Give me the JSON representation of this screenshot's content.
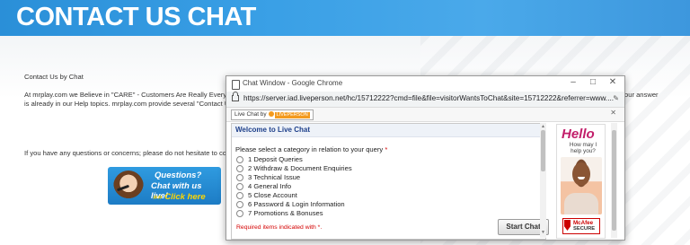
{
  "banner": {
    "title": "CONTACT US CHAT"
  },
  "page": {
    "heading": "Contact Us by Chat",
    "para1_line1": "At mrplay.com we Believe in \"CARE\" - Customers Are Really Everything",
    "para1_line1_tail": "our answer",
    "para1_line2": "is already in our Help topics. mrplay.com provide several \"Contact Us\"",
    "para2": "If you have any questions or concerns; please do not hesitate to contac"
  },
  "chat_button": {
    "line1": "Questions?",
    "line2": "Chat with us live!",
    "line3": "»» Click here"
  },
  "popup": {
    "window_title": "Chat Window - Google Chrome",
    "url": "https://server.iad.liveperson.net/hc/15712222?cmd=file&file=visitorWantsToChat&site=15712222&referrer=www....",
    "lp_badge_text": "Live Chat by",
    "lp_brand": "LIVEPERSON",
    "welcome": "Welcome to Live Chat",
    "prompt": "Please select a category in relation to your query",
    "required_marker": "*",
    "options": [
      "1 Deposit Queries",
      "2 Withdraw & Document Enquiries",
      "3 Technical Issue",
      "4 General Info",
      "5 Close Account",
      "6 Password & Login Information",
      "7 Promotions & Bonuses"
    ],
    "required_note": "Required items indicated with *.",
    "start_chat": "Start Chat"
  },
  "ad": {
    "hello": "Hello",
    "sub": "How may I help you?",
    "badge_line1": "McAfee",
    "badge_line2": "SECURE"
  },
  "colors": {
    "banner": "#2a8fd8",
    "link_blue": "#1d3f8a",
    "required_red": "#d40000",
    "accent_orange": "#f39a1e"
  }
}
